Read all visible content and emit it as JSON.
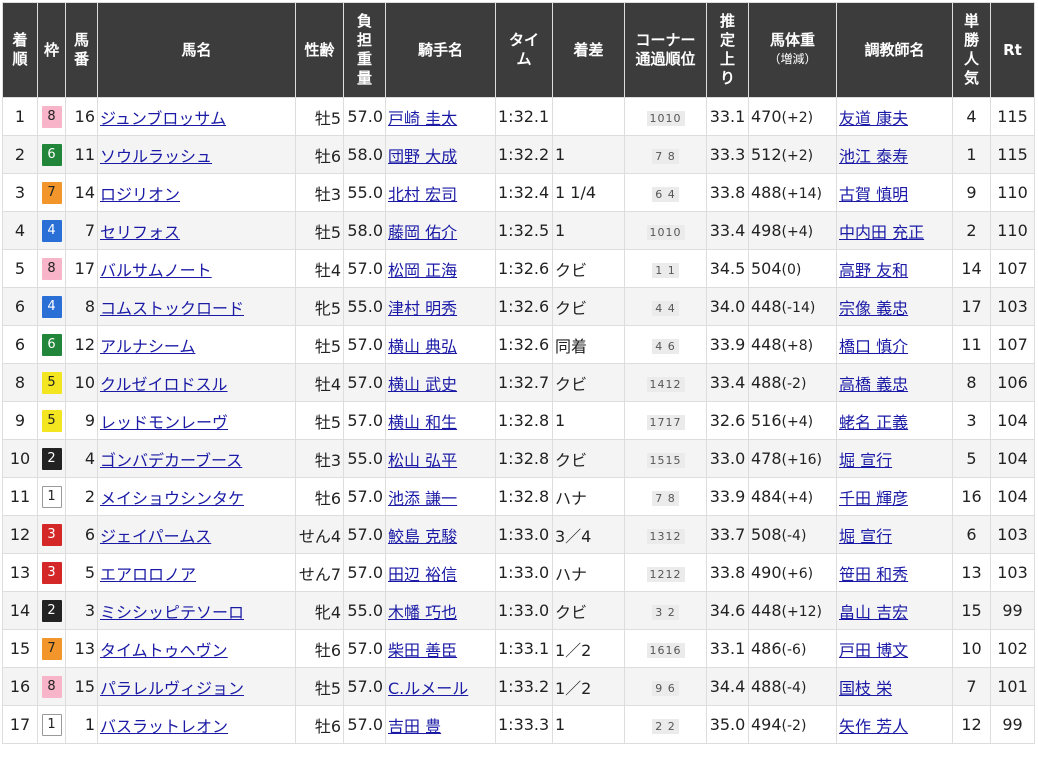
{
  "headers": {
    "rank": [
      "着",
      "順"
    ],
    "waku": [
      "枠"
    ],
    "num": [
      "馬",
      "番"
    ],
    "horse": [
      "馬名"
    ],
    "sexage": [
      "性齢"
    ],
    "weight": [
      "負",
      "担",
      "重",
      "量"
    ],
    "jockey": [
      "騎手名"
    ],
    "time": [
      "タイ",
      "ム"
    ],
    "margin": [
      "着差"
    ],
    "corner": [
      "コーナー",
      "通過順位"
    ],
    "last3f": [
      "推",
      "定",
      "上",
      "り"
    ],
    "body": [
      "馬体重",
      "（増減）"
    ],
    "trainer": [
      "調教師名"
    ],
    "pop": [
      "単",
      "勝",
      "人",
      "気"
    ],
    "rt": [
      "Rt"
    ]
  },
  "waku_colors": {
    "1": {
      "bg": "#ffffff",
      "fg": "#222222",
      "border": "#999999"
    },
    "2": {
      "bg": "#222222",
      "fg": "#ffffff",
      "border": "#222222"
    },
    "3": {
      "bg": "#d42828",
      "fg": "#ffffff",
      "border": "#d42828"
    },
    "4": {
      "bg": "#2a6fd6",
      "fg": "#ffffff",
      "border": "#2a6fd6"
    },
    "5": {
      "bg": "#f3e51f",
      "fg": "#222222",
      "border": "#f3e51f"
    },
    "6": {
      "bg": "#22863a",
      "fg": "#ffffff",
      "border": "#22863a"
    },
    "7": {
      "bg": "#f2962b",
      "fg": "#222222",
      "border": "#f2962b"
    },
    "8": {
      "bg": "#f8b4c8",
      "fg": "#222222",
      "border": "#f8b4c8"
    }
  },
  "rows": [
    {
      "rank": "1",
      "waku": "8",
      "num": "16",
      "horse": "ジュンブロッサム",
      "sexage": "牡5",
      "weight": "57.0",
      "jockey": "戸崎 圭太",
      "time": "1:32.1",
      "margin": "",
      "corner": "1010",
      "last3f": "33.1",
      "body": "470",
      "diff": "(+2)",
      "trainer": "友道 康夫",
      "pop": "4",
      "rt": "115"
    },
    {
      "rank": "2",
      "waku": "6",
      "num": "11",
      "horse": "ソウルラッシュ",
      "sexage": "牡6",
      "weight": "58.0",
      "jockey": "団野 大成",
      "time": "1:32.2",
      "margin": "1",
      "corner": "7 8",
      "last3f": "33.3",
      "body": "512",
      "diff": "(+2)",
      "trainer": "池江 泰寿",
      "pop": "1",
      "rt": "115"
    },
    {
      "rank": "3",
      "waku": "7",
      "num": "14",
      "horse": "ロジリオン",
      "sexage": "牡3",
      "weight": "55.0",
      "jockey": "北村 宏司",
      "time": "1:32.4",
      "margin": "1 1/4",
      "corner": "6 4",
      "last3f": "33.8",
      "body": "488",
      "diff": "(+14)",
      "trainer": "古賀 慎明",
      "pop": "9",
      "rt": "110"
    },
    {
      "rank": "4",
      "waku": "4",
      "num": "7",
      "horse": "セリフォス",
      "sexage": "牡5",
      "weight": "58.0",
      "jockey": "藤岡 佑介",
      "time": "1:32.5",
      "margin": "1",
      "corner": "1010",
      "last3f": "33.4",
      "body": "498",
      "diff": "(+4)",
      "trainer": "中内田 充正",
      "pop": "2",
      "rt": "110"
    },
    {
      "rank": "5",
      "waku": "8",
      "num": "17",
      "horse": "バルサムノート",
      "sexage": "牡4",
      "weight": "57.0",
      "jockey": "松岡 正海",
      "time": "1:32.6",
      "margin": "クビ",
      "corner": "1 1",
      "last3f": "34.5",
      "body": "504",
      "diff": "(0)",
      "trainer": "高野 友和",
      "pop": "14",
      "rt": "107"
    },
    {
      "rank": "6",
      "waku": "4",
      "num": "8",
      "horse": "コムストックロード",
      "sexage": "牝5",
      "weight": "55.0",
      "jockey": "津村 明秀",
      "time": "1:32.6",
      "margin": "クビ",
      "corner": "4 4",
      "last3f": "34.0",
      "body": "448",
      "diff": "(-14)",
      "trainer": "宗像 義忠",
      "pop": "17",
      "rt": "103"
    },
    {
      "rank": "6",
      "waku": "6",
      "num": "12",
      "horse": "アルナシーム",
      "sexage": "牡5",
      "weight": "57.0",
      "jockey": "横山 典弘",
      "time": "1:32.6",
      "margin": "同着",
      "corner": "4 6",
      "last3f": "33.9",
      "body": "448",
      "diff": "(+8)",
      "trainer": "橋口 慎介",
      "pop": "11",
      "rt": "107"
    },
    {
      "rank": "8",
      "waku": "5",
      "num": "10",
      "horse": "クルゼイロドスル",
      "sexage": "牡4",
      "weight": "57.0",
      "jockey": "横山 武史",
      "time": "1:32.7",
      "margin": "クビ",
      "corner": "1412",
      "last3f": "33.4",
      "body": "488",
      "diff": "(-2)",
      "trainer": "高橋 義忠",
      "pop": "8",
      "rt": "106"
    },
    {
      "rank": "9",
      "waku": "5",
      "num": "9",
      "horse": "レッドモンレーヴ",
      "sexage": "牡5",
      "weight": "57.0",
      "jockey": "横山 和生",
      "time": "1:32.8",
      "margin": "1",
      "corner": "1717",
      "last3f": "32.6",
      "body": "516",
      "diff": "(+4)",
      "trainer": "蛯名 正義",
      "pop": "3",
      "rt": "104"
    },
    {
      "rank": "10",
      "waku": "2",
      "num": "4",
      "horse": "ゴンバデカーブース",
      "sexage": "牡3",
      "weight": "55.0",
      "jockey": "松山 弘平",
      "time": "1:32.8",
      "margin": "クビ",
      "corner": "1515",
      "last3f": "33.0",
      "body": "478",
      "diff": "(+16)",
      "trainer": "堀 宣行",
      "pop": "5",
      "rt": "104"
    },
    {
      "rank": "11",
      "waku": "1",
      "num": "2",
      "horse": "メイショウシンタケ",
      "sexage": "牡6",
      "weight": "57.0",
      "jockey": "池添 謙一",
      "time": "1:32.8",
      "margin": "ハナ",
      "corner": "7 8",
      "last3f": "33.9",
      "body": "484",
      "diff": "(+4)",
      "trainer": "千田 輝彦",
      "pop": "16",
      "rt": "104"
    },
    {
      "rank": "12",
      "waku": "3",
      "num": "6",
      "horse": "ジェイパームス",
      "sexage": "せん4",
      "weight": "57.0",
      "jockey": "鮫島 克駿",
      "time": "1:33.0",
      "margin": "3／4",
      "corner": "1312",
      "last3f": "33.7",
      "body": "508",
      "diff": "(-4)",
      "trainer": "堀 宣行",
      "pop": "6",
      "rt": "103"
    },
    {
      "rank": "13",
      "waku": "3",
      "num": "5",
      "horse": "エアロロノア",
      "sexage": "せん7",
      "weight": "57.0",
      "jockey": "田辺 裕信",
      "time": "1:33.0",
      "margin": "ハナ",
      "corner": "1212",
      "last3f": "33.8",
      "body": "490",
      "diff": "(+6)",
      "trainer": "笹田 和秀",
      "pop": "13",
      "rt": "103"
    },
    {
      "rank": "14",
      "waku": "2",
      "num": "3",
      "horse": "ミシシッピテソーロ",
      "sexage": "牝4",
      "weight": "55.0",
      "jockey": "木幡 巧也",
      "time": "1:33.0",
      "margin": "クビ",
      "corner": "3 2",
      "last3f": "34.6",
      "body": "448",
      "diff": "(+12)",
      "trainer": "畠山 吉宏",
      "pop": "15",
      "rt": "99"
    },
    {
      "rank": "15",
      "waku": "7",
      "num": "13",
      "horse": "タイムトゥヘヴン",
      "sexage": "牡6",
      "weight": "57.0",
      "jockey": "柴田 善臣",
      "time": "1:33.1",
      "margin": "1／2",
      "corner": "1616",
      "last3f": "33.1",
      "body": "486",
      "diff": "(-6)",
      "trainer": "戸田 博文",
      "pop": "10",
      "rt": "102"
    },
    {
      "rank": "16",
      "waku": "8",
      "num": "15",
      "horse": "パラレルヴィジョン",
      "sexage": "牡5",
      "weight": "57.0",
      "jockey": "C.ルメール",
      "time": "1:33.2",
      "margin": "1／2",
      "corner": "9 6",
      "last3f": "34.4",
      "body": "488",
      "diff": "(-4)",
      "trainer": "国枝 栄",
      "pop": "7",
      "rt": "101"
    },
    {
      "rank": "17",
      "waku": "1",
      "num": "1",
      "horse": "バスラットレオン",
      "sexage": "牡6",
      "weight": "57.0",
      "jockey": "吉田 豊",
      "time": "1:33.3",
      "margin": "1",
      "corner": "2 2",
      "last3f": "35.0",
      "body": "494",
      "diff": "(-2)",
      "trainer": "矢作 芳人",
      "pop": "12",
      "rt": "99"
    }
  ]
}
